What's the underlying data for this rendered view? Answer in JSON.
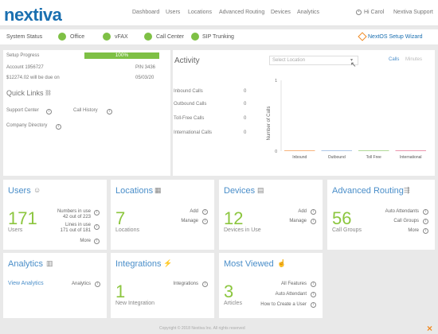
{
  "header": {
    "logo": "nextiva",
    "nav": [
      "Dashboard",
      "Users",
      "Locations",
      "Advanced Routing",
      "Devices",
      "Analytics"
    ],
    "greeting": "Hi Carol",
    "support": "Nextiva Support"
  },
  "status_bar": {
    "label": "System Status",
    "items": [
      "Office",
      "vFAX",
      "Call Center",
      "SIP Trunking"
    ],
    "wizard": "NextOS Setup Wizard"
  },
  "account": {
    "setup_label": "Setup Progress",
    "progress_text": "100%",
    "progress_value": 1.0,
    "account_label": "Account 1956727",
    "pin": "PIN 3436",
    "due": "$12274.02 will be due on",
    "due_date": "05/03/20"
  },
  "quick_links": {
    "title": "Quick Links",
    "items": [
      "Support Center",
      "Call History",
      "Company Directory"
    ]
  },
  "activity": {
    "title": "Activity",
    "select_placeholder": "Select Location",
    "tabs": [
      "Calls",
      "Minutes"
    ],
    "rows": [
      {
        "label": "Inbound Calls",
        "value": "0"
      },
      {
        "label": "Outbound Calls",
        "value": "0"
      },
      {
        "label": "Toll-Free Calls",
        "value": "0"
      },
      {
        "label": "International Calls",
        "value": "0"
      }
    ],
    "chart_data": {
      "type": "bar",
      "categories": [
        "Inbound",
        "Outbound",
        "Toll Free",
        "International"
      ],
      "values": [
        0,
        0,
        0,
        0
      ],
      "ylabel": "Number of Calls",
      "ylim": [
        0,
        1
      ],
      "y_ticks": [
        "1",
        "0"
      ],
      "colors": [
        "#f5a25d",
        "#9ab9e0",
        "#9ccf7c",
        "#e57c9b"
      ]
    }
  },
  "tiles": {
    "users": {
      "title": "Users",
      "big": "171",
      "sub": "Users",
      "numbers_in_use": "Numbers in use",
      "numbers_count": "42 out of 223",
      "lines_in_use": "Lines in use",
      "lines_count": "171 out of 181",
      "more": "More"
    },
    "locations": {
      "title": "Locations",
      "big": "7",
      "sub": "Locations",
      "add": "Add",
      "manage": "Manage"
    },
    "devices": {
      "title": "Devices",
      "big": "12",
      "sub": "Devices in Use",
      "add": "Add",
      "manage": "Manage"
    },
    "routing": {
      "title": "Advanced Routing",
      "big": "56",
      "sub": "Call Groups",
      "items": [
        "Auto Attendants",
        "Call Groups",
        "More"
      ]
    },
    "analytics": {
      "title": "Analytics",
      "link": "View Analytics",
      "right": "Analytics"
    },
    "integrations": {
      "title": "Integrations",
      "big": "1",
      "sub": "New Integration",
      "right": "Integrations"
    },
    "most_viewed": {
      "title": "Most Viewed",
      "big": "3",
      "sub": "Articles",
      "items": [
        "All Features",
        "Auto Attendant",
        "How to Create a User"
      ]
    }
  },
  "footer": "Copyright © 2018 Nextiva Inc. All rights reserved"
}
